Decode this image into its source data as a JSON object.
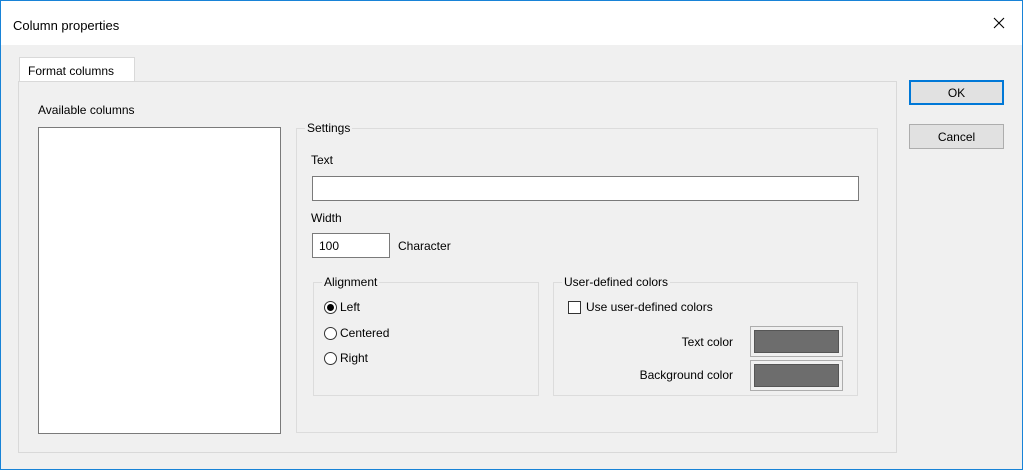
{
  "window": {
    "title": "Column properties",
    "close_icon": "close-icon"
  },
  "tabs": [
    {
      "label": "Format columns",
      "active": true
    }
  ],
  "available_columns": {
    "label": "Available columns",
    "items": []
  },
  "settings": {
    "legend": "Settings",
    "text": {
      "label": "Text",
      "value": ""
    },
    "width": {
      "label": "Width",
      "value": "100",
      "unit_label": "Character"
    },
    "alignment": {
      "legend": "Alignment",
      "options": [
        {
          "label": "Left",
          "selected": true
        },
        {
          "label": "Centered",
          "selected": false
        },
        {
          "label": "Right",
          "selected": false
        }
      ]
    },
    "user_colors": {
      "legend": "User-defined colors",
      "use_checkbox": {
        "label": "Use user-defined colors",
        "checked": false
      },
      "text_color": {
        "label": "Text color",
        "color": "#6d6d6d"
      },
      "background_color": {
        "label": "Background color",
        "color": "#6d6d6d"
      }
    }
  },
  "buttons": {
    "ok": "OK",
    "cancel": "Cancel"
  },
  "colors": {
    "accent": "#0078d7",
    "window_border": "#1883d7",
    "dialog_bg": "#f0f0f0"
  }
}
